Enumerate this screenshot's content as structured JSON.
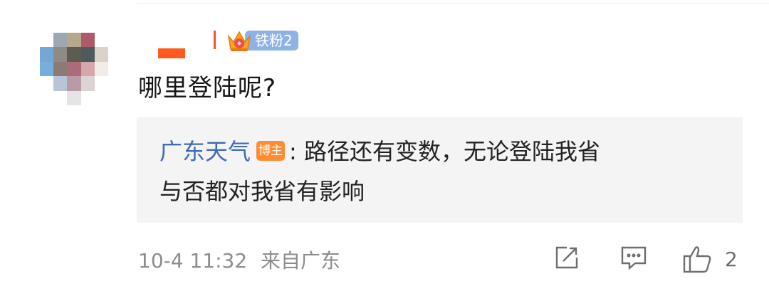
{
  "comment": {
    "badge_label": "铁粉2",
    "text": "哪里登陆呢?",
    "timestamp": "10-4 11:32",
    "source": "来自广东",
    "like_count": "2"
  },
  "reply": {
    "author": "广东天气",
    "author_tag": "博主",
    "line1_body": ": 路径还有变数，无论登陆我省",
    "line2": "与否都对我省有影响"
  },
  "colors": {
    "reply_author": "#3f6ab4",
    "author_tag_bg": "#ff8c32",
    "badge_bg": "#8fb2e6",
    "reply_bg": "#f4f4f4",
    "meta_text": "#8c8c8c"
  },
  "icons": [
    "crown-icon",
    "repost-icon",
    "comment-icon",
    "like-icon"
  ]
}
